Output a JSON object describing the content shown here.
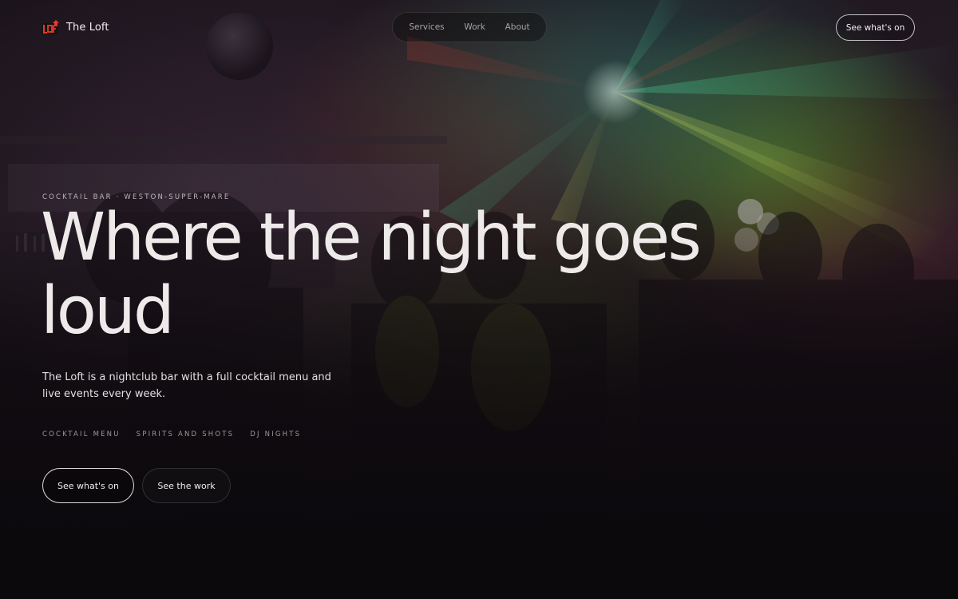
{
  "brand": {
    "name": "The Loft",
    "logo_icon": "loft-logo-icon",
    "accent": "#d42a2a"
  },
  "nav": {
    "items": [
      {
        "label": "Services"
      },
      {
        "label": "Work"
      },
      {
        "label": "About"
      }
    ]
  },
  "header_cta": {
    "label": "See what's on"
  },
  "hero": {
    "eyebrow": "COCKTAIL BAR · WESTON-SUPER-MARE",
    "headline": "Where the night goes loud",
    "intro": "The Loft is a nightclub bar with a full cocktail menu and live events every week.",
    "tags": [
      "COCKTAIL MENU",
      "SPIRITS AND SHOTS",
      "DJ NIGHTS"
    ],
    "buttons": {
      "primary": "See what's on",
      "secondary": "See the work"
    }
  },
  "colors": {
    "background": "#0c090d",
    "text": "#edeae9",
    "muted": "#9e979b"
  }
}
